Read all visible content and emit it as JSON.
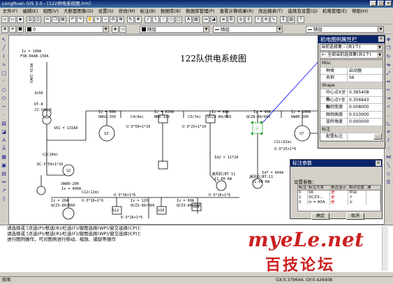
{
  "window": {
    "title": "LongRuan GIS 3.0 - [122供电系统图.lrm]"
  },
  "menu": [
    "文件(F)",
    "编辑(E)",
    "视图(V)",
    "大断面图像(D)",
    "设置(S)",
    "修改(M)",
    "标注(B)",
    "数据库(B)",
    "数据库管理(P)",
    "查看计算结果(R)",
    "改出报表(T)",
    "选择及设置(Q)",
    "机电管理(E)",
    "帮助(H)"
  ],
  "toolbar": {
    "layer_value": "0",
    "linetype1": "随层",
    "linetype2": "随层",
    "linetype3": "随层"
  },
  "diagram": {
    "title": "122队供电系统图",
    "labels": [
      "Iz = 100A",
      "FSB-66AB-150A",
      "MYJV-10KV",
      "3x50",
      "DT-8",
      "JJ-100/6",
      "S61 = 1318A",
      "C2(10m)",
      "DC-3*50+1*16",
      "S2",
      "DW80-200",
      "Iz = 400A",
      "Iz = 60A",
      "DWGO-350",
      "S3",
      "C4(6m)",
      "Iz = 624A",
      "BKD-120",
      "U-3*50+1*10",
      "C3(7m)",
      "Iz = 40A",
      "QCZ3-80/660",
      "U-3*25+1*10",
      "Iz = 40A",
      "QCZ8-80/660",
      "S7",
      "Iz = 200A",
      "DW80-200",
      "C2i(62m)",
      "U-3*25+1*6",
      "Id2 = 1172A",
      "通风机(BT-11",
      "11.00 KW",
      "Id7 = 604A",
      "通风机(BT-11",
      "11.00 KW",
      "Iz = 20A",
      "QCZ3-80/660",
      "C12(12m)",
      "U-3*16+1*6",
      "S12",
      "Iz = 120",
      "QCZ3-80/660",
      "S10",
      "Iz = 60A",
      "QCZ3-80/660",
      "S10",
      "U-3*16+1*6",
      "U-3*16+1*6",
      "U-3*16+1*6"
    ]
  },
  "properties_panel": {
    "title": "机电图例属性栏",
    "select1": "当前选择集 - (共1个)",
    "select2": "+- 全部当前选择集(共1个)",
    "misc_group": "Misc",
    "rows": [
      {
        "key": "种类",
        "value": "启动器"
      },
      {
        "key": "名称",
        "value": "S6"
      }
    ],
    "shape_group": "Shape",
    "shape_rows": [
      {
        "key": "中心点X坐标",
        "value": "0.385408"
      },
      {
        "key": "中心点Y坐标",
        "value": "0.356843"
      },
      {
        "key": "图例宽度",
        "value": "0.008000"
      },
      {
        "key": "图例高度",
        "value": "0.010000"
      },
      {
        "key": "旋转角度",
        "value": "0.000000"
      }
    ],
    "annot_group": "标注",
    "annot_row": {
      "key": "配置标注",
      "value": ""
    },
    "browse_btn": "..."
  },
  "annotation_dialog": {
    "title": "标注参数",
    "subtitle": "设置参数：",
    "headers": [
      "标注",
      "标注文本",
      "是否显示",
      "相对位置",
      "通"
    ],
    "rows": [
      [
        "0",
        "S6",
        "是",
        "中间",
        ""
      ],
      [
        "1",
        "QCZ3-..",
        "是",
        "下",
        ""
      ],
      [
        "2",
        "Iz = 40A",
        "是",
        "上",
        ""
      ]
    ],
    "ok": "确定",
    "cancel": "取消"
  },
  "command_lines": [
    "请选择或 [点选(P)/框选(R)/栏选(F)/窗图选择(WP)/窗交选择(CP)]：",
    "请选择或 [点选(P)/框选(R)/栏选(F)/窗图选择(WP)/窗交选择(CP)]：",
    "    进行图例操作，可对图例进行移动、缩放、捕捉等操作"
  ],
  "status": {
    "left": "就绪",
    "coords": "GX:0.379644, GY:0.426408"
  },
  "watermark": {
    "line1": "myeLe.net",
    "line2": "百技论坛"
  },
  "colors": {
    "titlebar": "#0a246a",
    "selection": "#1aa01a",
    "watermark": "#cc1f1f"
  }
}
